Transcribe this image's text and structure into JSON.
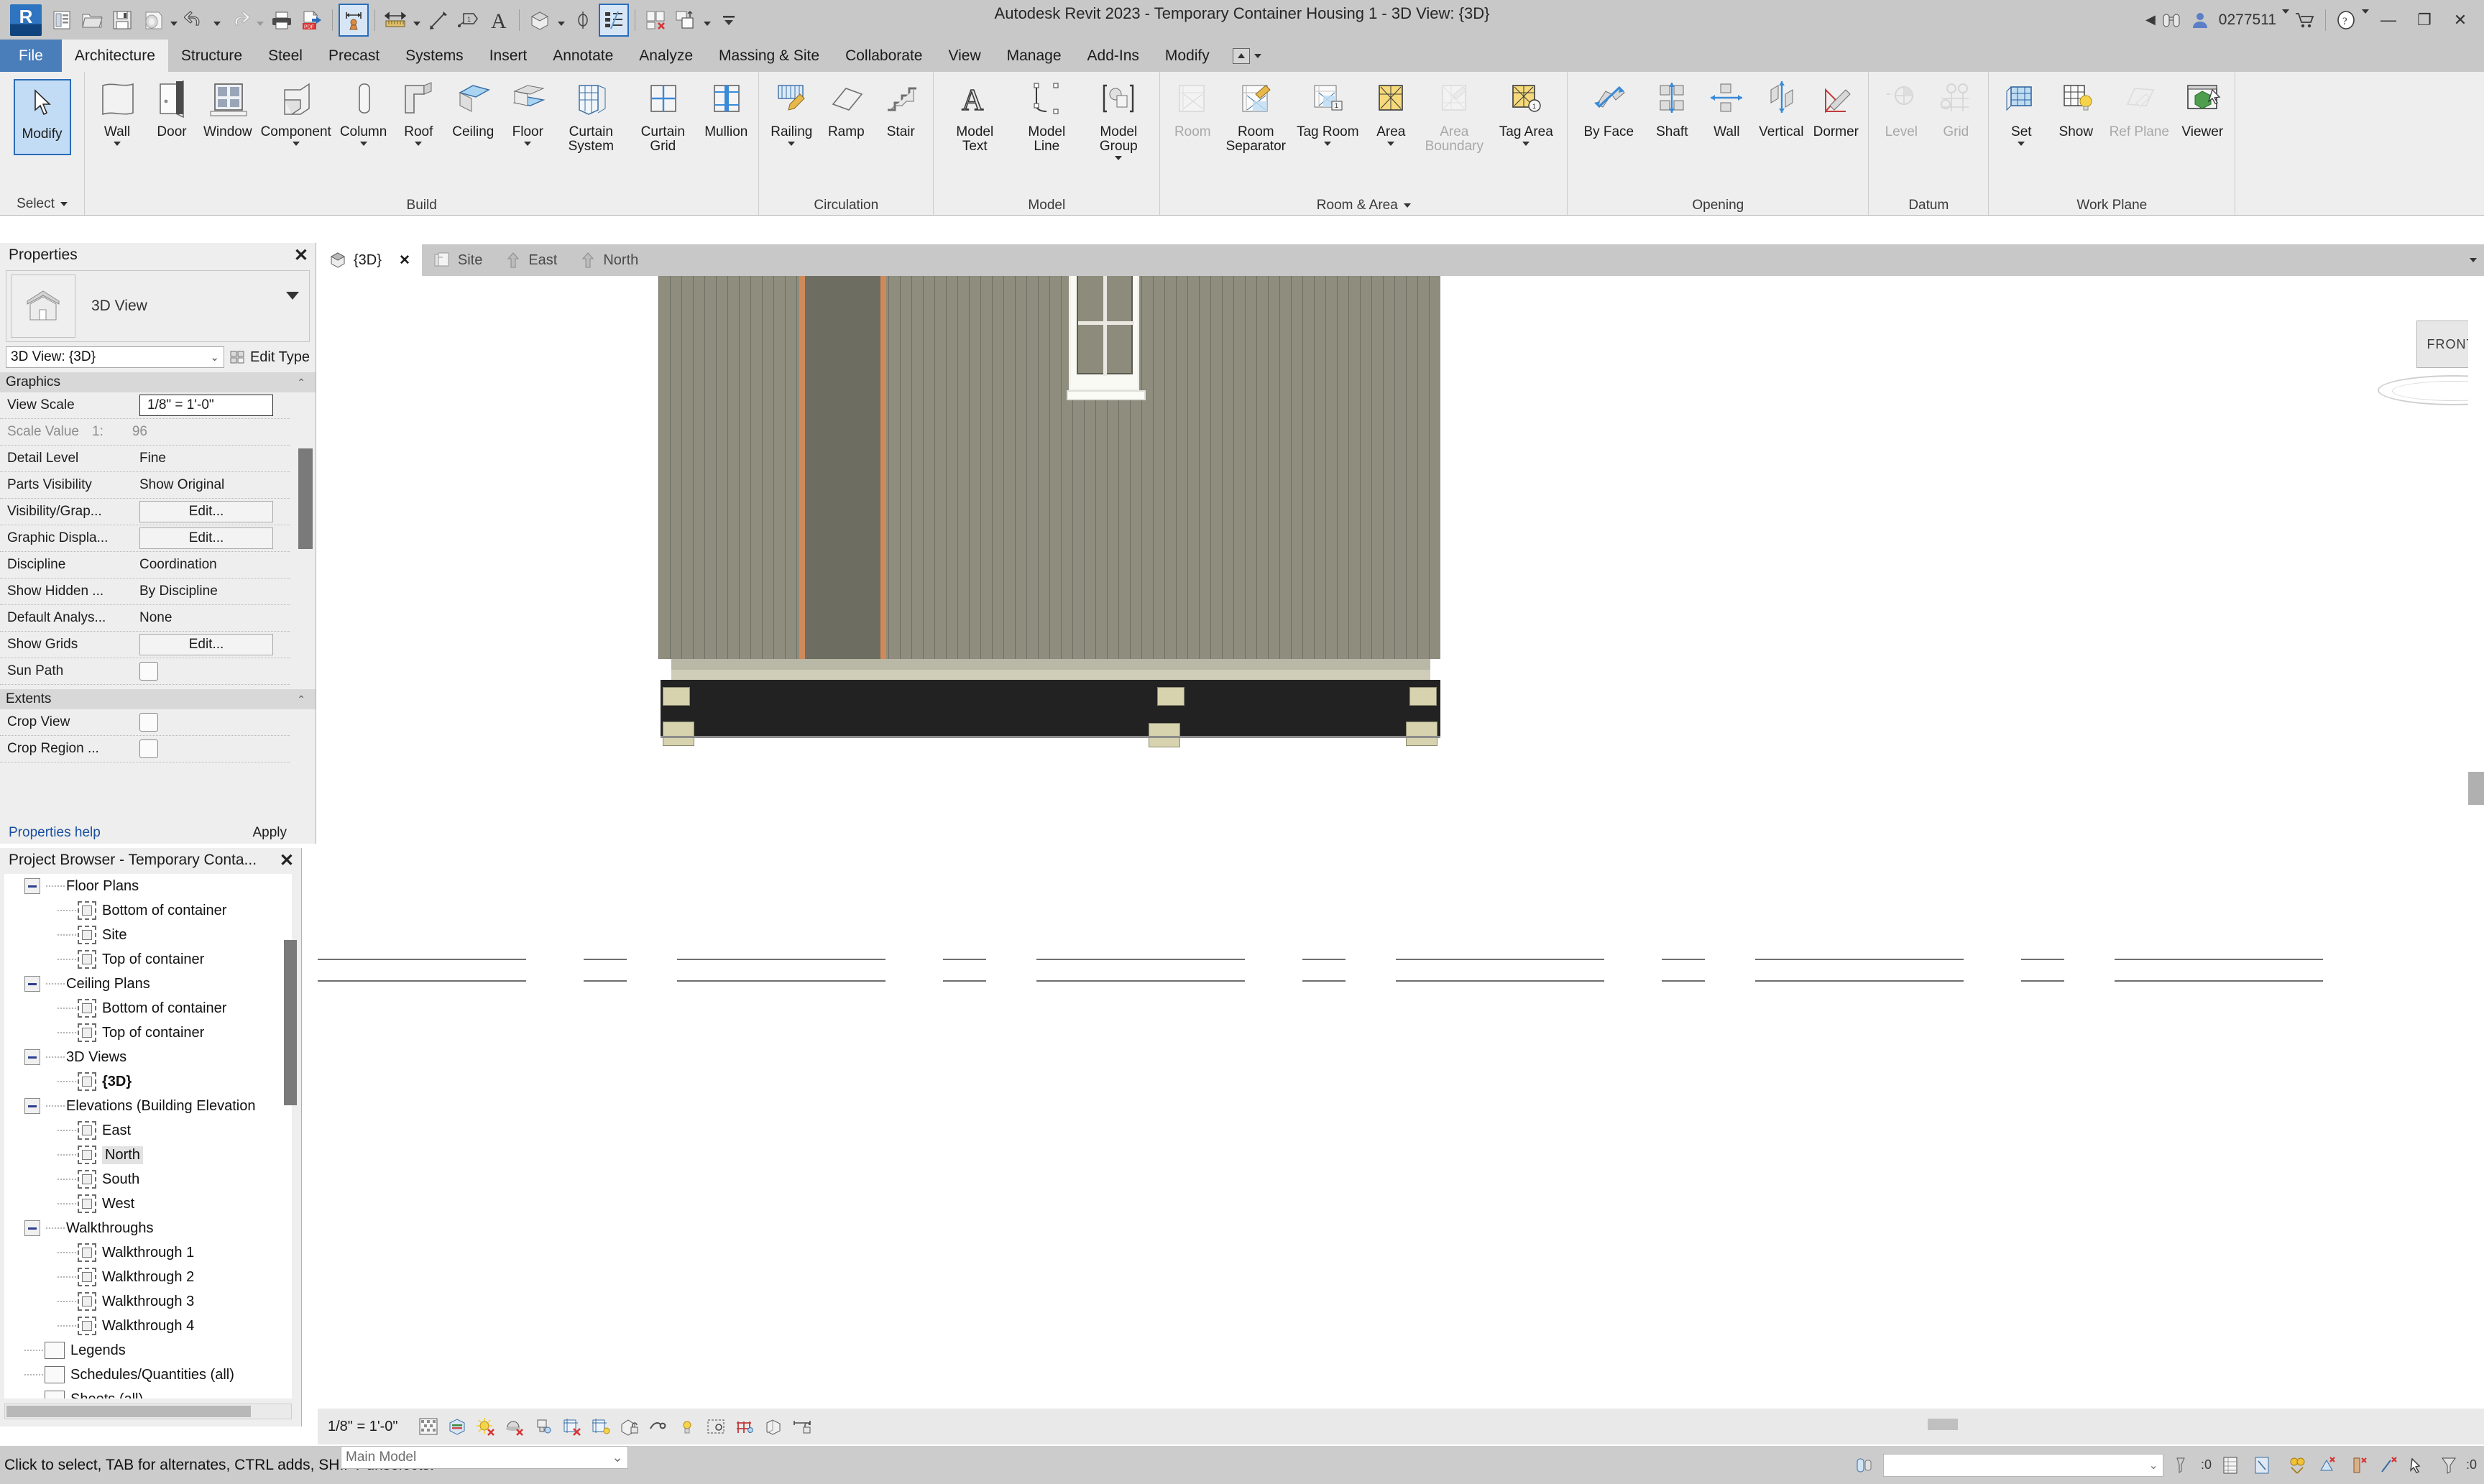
{
  "window": {
    "title": "Autodesk Revit 2023 - Temporary Container Housing 1 - 3D View: {3D}",
    "user_id": "0277511",
    "minimize": "—",
    "restore": "❐",
    "close": "✕"
  },
  "quick_access": {
    "items": [
      {
        "name": "revit-logo",
        "label": "R"
      },
      {
        "name": "new-project-icon",
        "label": "New"
      },
      {
        "name": "open-icon",
        "label": "Open"
      },
      {
        "name": "save-icon",
        "label": "Save"
      },
      {
        "name": "save-as-icon",
        "label": "Save As"
      },
      {
        "name": "undo-icon",
        "label": "Undo"
      },
      {
        "name": "redo-icon",
        "label": "Redo"
      },
      {
        "name": "print-icon",
        "label": "Print"
      },
      {
        "name": "export-pdf-icon",
        "label": "Export PDF"
      },
      {
        "name": "measure-between-icon",
        "label": "Measure Between Two References"
      },
      {
        "name": "aligned-dimension-icon",
        "label": "Aligned Dimension"
      },
      {
        "name": "tag-icon",
        "label": "Tag by Category"
      },
      {
        "name": "text-icon",
        "label": "Text"
      },
      {
        "name": "default-3d-view-icon",
        "label": "Default 3D View"
      },
      {
        "name": "section-icon",
        "label": "Section"
      },
      {
        "name": "thin-lines-icon",
        "label": "Thin Lines"
      },
      {
        "name": "close-hidden-windows-icon",
        "label": "Close Hidden Windows"
      },
      {
        "name": "switch-windows-icon",
        "label": "Switch Windows"
      },
      {
        "name": "customize-qat-icon",
        "label": "Customize Quick Access Toolbar"
      }
    ]
  },
  "ribbon": {
    "tabs": [
      {
        "label": "File",
        "active": false,
        "kind": "file"
      },
      {
        "label": "Architecture",
        "active": true
      },
      {
        "label": "Structure",
        "active": false
      },
      {
        "label": "Steel",
        "active": false
      },
      {
        "label": "Precast",
        "active": false
      },
      {
        "label": "Systems",
        "active": false
      },
      {
        "label": "Insert",
        "active": false
      },
      {
        "label": "Annotate",
        "active": false
      },
      {
        "label": "Analyze",
        "active": false
      },
      {
        "label": "Massing & Site",
        "active": false
      },
      {
        "label": "Collaborate",
        "active": false
      },
      {
        "label": "View",
        "active": false
      },
      {
        "label": "Manage",
        "active": false
      },
      {
        "label": "Add-Ins",
        "active": false
      },
      {
        "label": "Modify",
        "active": false
      }
    ],
    "select_panel": {
      "button": "Modify",
      "title": "Select"
    },
    "panels": [
      {
        "title": "Build",
        "items": [
          {
            "label": "Wall",
            "icon": "wall-icon",
            "dropdown": true,
            "disabled": false
          },
          {
            "label": "Door",
            "icon": "door-icon",
            "dropdown": false,
            "disabled": false
          },
          {
            "label": "Window",
            "icon": "window-icon",
            "dropdown": false,
            "disabled": false
          },
          {
            "label": "Component",
            "icon": "component-icon",
            "dropdown": true,
            "disabled": false
          },
          {
            "label": "Column",
            "icon": "column-icon",
            "dropdown": true,
            "disabled": false
          },
          {
            "label": "Roof",
            "icon": "roof-icon",
            "dropdown": true,
            "disabled": false
          },
          {
            "label": "Ceiling",
            "icon": "ceiling-icon",
            "dropdown": false,
            "disabled": false
          },
          {
            "label": "Floor",
            "icon": "floor-icon",
            "dropdown": true,
            "disabled": false
          },
          {
            "label": "Curtain System",
            "icon": "curtain-system-icon",
            "dropdown": false,
            "disabled": false
          },
          {
            "label": "Curtain Grid",
            "icon": "curtain-grid-icon",
            "dropdown": false,
            "disabled": false
          },
          {
            "label": "Mullion",
            "icon": "mullion-icon",
            "dropdown": false,
            "disabled": false
          }
        ]
      },
      {
        "title": "Circulation",
        "items": [
          {
            "label": "Railing",
            "icon": "railing-icon",
            "dropdown": true,
            "disabled": false
          },
          {
            "label": "Ramp",
            "icon": "ramp-icon",
            "dropdown": false,
            "disabled": false
          },
          {
            "label": "Stair",
            "icon": "stair-icon",
            "dropdown": false,
            "disabled": false
          }
        ]
      },
      {
        "title": "Model",
        "items": [
          {
            "label": "Model Text",
            "icon": "model-text-icon",
            "dropdown": false,
            "disabled": false
          },
          {
            "label": "Model Line",
            "icon": "model-line-icon",
            "dropdown": false,
            "disabled": false
          },
          {
            "label": "Model Group",
            "icon": "model-group-icon",
            "dropdown": true,
            "disabled": false
          }
        ]
      },
      {
        "title": "Room & Area",
        "title_dropdown": true,
        "items": [
          {
            "label": "Room",
            "icon": "room-icon",
            "dropdown": false,
            "disabled": true
          },
          {
            "label": "Room Separator",
            "icon": "room-separator-icon",
            "dropdown": false,
            "disabled": false
          },
          {
            "label": "Tag Room",
            "icon": "tag-room-icon",
            "dropdown": true,
            "disabled": false
          },
          {
            "label": "Area",
            "icon": "area-icon",
            "dropdown": true,
            "disabled": false
          },
          {
            "label": "Area Boundary",
            "icon": "area-boundary-icon",
            "dropdown": false,
            "disabled": true
          },
          {
            "label": "Tag Area",
            "icon": "tag-area-icon",
            "dropdown": true,
            "disabled": false
          }
        ]
      },
      {
        "title": "Opening",
        "items": [
          {
            "label": "By Face",
            "icon": "by-face-icon",
            "dropdown": false,
            "disabled": false
          },
          {
            "label": "Shaft",
            "icon": "shaft-icon",
            "dropdown": false,
            "disabled": false
          },
          {
            "label": "Wall",
            "icon": "wall-opening-icon",
            "dropdown": false,
            "disabled": false
          },
          {
            "label": "Vertical",
            "icon": "vertical-opening-icon",
            "dropdown": false,
            "disabled": false
          },
          {
            "label": "Dormer",
            "icon": "dormer-icon",
            "dropdown": false,
            "disabled": false
          }
        ]
      },
      {
        "title": "Datum",
        "items": [
          {
            "label": "Level",
            "icon": "level-icon",
            "dropdown": false,
            "disabled": true
          },
          {
            "label": "Grid",
            "icon": "grid-icon",
            "dropdown": false,
            "disabled": true
          }
        ]
      },
      {
        "title": "Work Plane",
        "items": [
          {
            "label": "Set",
            "icon": "set-workplane-icon",
            "dropdown": true,
            "disabled": false
          },
          {
            "label": "Show",
            "icon": "show-workplane-icon",
            "dropdown": false,
            "disabled": false
          },
          {
            "label": "Ref Plane",
            "icon": "ref-plane-icon",
            "dropdown": false,
            "disabled": true
          },
          {
            "label": "Viewer",
            "icon": "workplane-viewer-icon",
            "dropdown": false,
            "disabled": false
          }
        ]
      }
    ]
  },
  "properties": {
    "title": "Properties",
    "close": "✕",
    "type_name": "3D View",
    "family": "3D View: {3D}",
    "edit_type": "Edit Type",
    "help_link": "Properties help",
    "apply": "Apply",
    "groups": [
      {
        "name": "Graphics",
        "rows": [
          {
            "key": "View Scale",
            "value": "1/8\" = 1'-0\"",
            "style": "boxed"
          },
          {
            "key": "Scale Value",
            "value": "96",
            "prefix": "1:",
            "style": "grey"
          },
          {
            "key": "Detail Level",
            "value": "Fine",
            "style": "text"
          },
          {
            "key": "Parts Visibility",
            "value": "Show Original",
            "style": "text"
          },
          {
            "key": "Visibility/Grap...",
            "value": "Edit...",
            "style": "button"
          },
          {
            "key": "Graphic Displa...",
            "value": "Edit...",
            "style": "button"
          },
          {
            "key": "Discipline",
            "value": "Coordination",
            "style": "text"
          },
          {
            "key": "Show Hidden ...",
            "value": "By Discipline",
            "style": "text"
          },
          {
            "key": "Default Analys...",
            "value": "None",
            "style": "text"
          },
          {
            "key": "Show Grids",
            "value": "Edit...",
            "style": "button"
          },
          {
            "key": "Sun Path",
            "value": "",
            "style": "checkbox"
          }
        ]
      },
      {
        "name": "Extents",
        "rows": [
          {
            "key": "Crop View",
            "value": "",
            "style": "checkbox"
          },
          {
            "key": "Crop Region ...",
            "value": "",
            "style": "checkbox"
          }
        ]
      }
    ]
  },
  "project_browser": {
    "title": "Project Browser - Temporary Conta...",
    "close": "✕",
    "nodes": [
      {
        "label": "Floor Plans",
        "level": 0,
        "type": "group",
        "expanded": true
      },
      {
        "label": "Bottom of container",
        "level": 1,
        "type": "view"
      },
      {
        "label": "Site",
        "level": 1,
        "type": "view"
      },
      {
        "label": "Top of container",
        "level": 1,
        "type": "view"
      },
      {
        "label": "Ceiling Plans",
        "level": 0,
        "type": "group",
        "expanded": true
      },
      {
        "label": "Bottom of container",
        "level": 1,
        "type": "view"
      },
      {
        "label": "Top of container",
        "level": 1,
        "type": "view"
      },
      {
        "label": "3D Views",
        "level": 0,
        "type": "group",
        "expanded": true
      },
      {
        "label": "{3D}",
        "level": 1,
        "type": "view",
        "bold": true
      },
      {
        "label": "Elevations (Building Elevation",
        "level": 0,
        "type": "group",
        "expanded": true
      },
      {
        "label": "East",
        "level": 1,
        "type": "view"
      },
      {
        "label": "North",
        "level": 1,
        "type": "view",
        "selected": true
      },
      {
        "label": "South",
        "level": 1,
        "type": "view"
      },
      {
        "label": "West",
        "level": 1,
        "type": "view"
      },
      {
        "label": "Walkthroughs",
        "level": 0,
        "type": "group",
        "expanded": true
      },
      {
        "label": "Walkthrough 1",
        "level": 1,
        "type": "view"
      },
      {
        "label": "Walkthrough 2",
        "level": 1,
        "type": "view"
      },
      {
        "label": "Walkthrough 3",
        "level": 1,
        "type": "view"
      },
      {
        "label": "Walkthrough 4",
        "level": 1,
        "type": "view"
      },
      {
        "label": "Legends",
        "level": 0,
        "type": "legend"
      },
      {
        "label": "Schedules/Quantities (all)",
        "level": 0,
        "type": "schedule"
      },
      {
        "label": "Sheets (all)",
        "level": 0,
        "type": "sheet"
      }
    ]
  },
  "view_tabs": [
    {
      "label": "{3D}",
      "icon": "3d-view-icon",
      "active": true,
      "closable": true
    },
    {
      "label": "Site",
      "icon": "floor-plan-icon",
      "active": false,
      "closable": false
    },
    {
      "label": "East",
      "icon": "elevation-icon",
      "active": false,
      "closable": false
    },
    {
      "label": "North",
      "icon": "elevation-icon",
      "active": false,
      "closable": false
    }
  ],
  "viewcube": {
    "face_label": "FRONT"
  },
  "view_control_bar": {
    "scale": "1/8\" = 1'-0\"",
    "icons": [
      "detail-level-icon",
      "visual-style-icon",
      "sun-path-icon",
      "shadows-icon",
      "rendering-dialog-icon",
      "crop-view-icon",
      "show-crop-region-icon",
      "unlock-3d-view-icon",
      "temporary-hide-isolate-icon",
      "reveal-hidden-elements-icon",
      "temporary-view-properties-icon",
      "analytical-model-icon",
      "constraints-icon",
      "reveal-constraints-icon"
    ]
  },
  "status_bar": {
    "message": "Click to select, TAB for alternates, CTRL adds, SHIFT unselects.",
    "filter_value": "",
    "selection_count": "0",
    "workset": "Main Model",
    "warning_count": "0",
    "icons": [
      "design-options-icon",
      "editable-only-icon",
      "worksets-icon",
      "exclude-options-icon",
      "press-drag-icon",
      "filter-icon"
    ]
  }
}
